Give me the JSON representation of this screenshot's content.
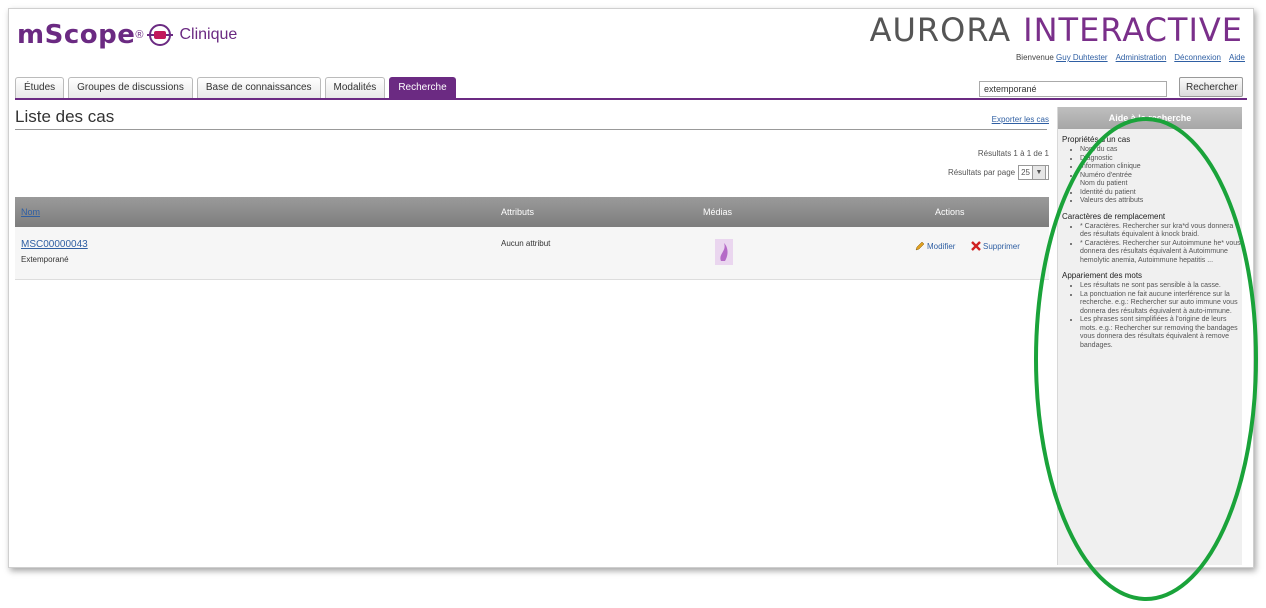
{
  "brand": {
    "left_main": "mScope",
    "left_reg": "®",
    "left_sub": "Clinique",
    "right_a": "AURORA",
    "right_b": "INTERACTIVE"
  },
  "userbar": {
    "welcome": "Bienvenue",
    "user": "Guy Duhtester",
    "admin": "Administration",
    "logout": "Déconnexion",
    "help": "Aide"
  },
  "tabs": [
    "Études",
    "Groupes de discussions",
    "Base de connaissances",
    "Modalités",
    "Recherche"
  ],
  "active_tab": "Recherche",
  "search": {
    "value": "extemporané",
    "button": "Rechercher"
  },
  "page": {
    "title": "Liste des cas",
    "export_link": "Exporter les cas",
    "results": "Résultats 1 à 1 de 1",
    "per_page_label": "Résultats par page",
    "per_page_value": "25"
  },
  "table": {
    "headers": [
      "Nom",
      "Attributs",
      "Médias",
      "Actions"
    ],
    "rows": [
      {
        "name": "MSC00000043",
        "sub": "Extemporané",
        "attributes": "Aucun attribut",
        "actions": {
          "edit": "Modifier",
          "delete": "Supprimer"
        }
      }
    ]
  },
  "help": {
    "title": "Aide à la recherche",
    "sections": [
      {
        "heading": "Propriétés d'un cas",
        "items": [
          "Nom du cas",
          "Diagnostic",
          "Information clinique",
          "Numéro d'entrée",
          "Nom du patient",
          "Identité du patient",
          "Valeurs des attributs"
        ]
      },
      {
        "heading": "Caractères de remplacement",
        "items": [
          "* Caractères. Rechercher sur kra*d vous donnera des résultats équivalent à knock braid.",
          "* Caractères. Rechercher sur Autoimmune he* vous donnera des résultats équivalent à Autoimmune hemolytic anemia, Autoimmune hepatitis ..."
        ]
      },
      {
        "heading": "Appariement des mots",
        "items": [
          "Les résultats ne sont pas sensible à la casse.",
          "La ponctuation ne fait aucune interférence sur la recherche. e.g.: Rechercher sur auto immune vous donnera des résultats équivalent à auto-immune.",
          "Les phrases sont simplifiées à l'origine de leurs mots. e.g.: Rechercher sur removing the bandages vous donnera des résultats équivalent à remove bandages."
        ]
      }
    ]
  },
  "colors": {
    "accent": "#6b2a82",
    "link": "#2f5fa3",
    "annotation": "#1aa33a"
  }
}
